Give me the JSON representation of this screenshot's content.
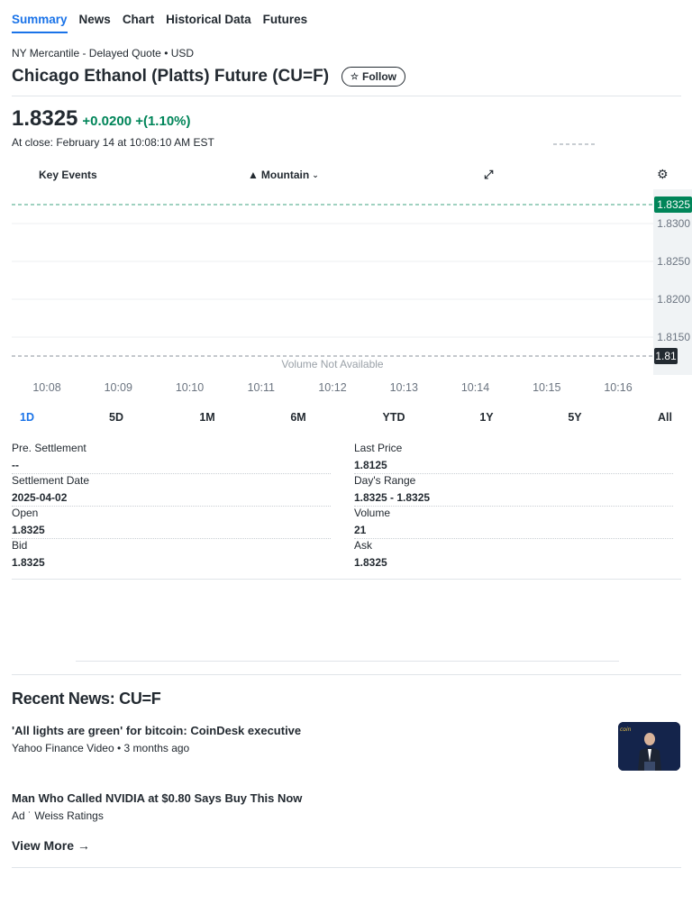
{
  "tabs": [
    {
      "label": "Summary",
      "active": true
    },
    {
      "label": "News",
      "active": false
    },
    {
      "label": "Chart",
      "active": false
    },
    {
      "label": "Historical Data",
      "active": false
    },
    {
      "label": "Futures",
      "active": false
    }
  ],
  "quote": {
    "exchange": "NY Mercantile - Delayed Quote • USD",
    "title": "Chicago Ethanol (Platts) Future (CU=F)",
    "follow_label": "Follow",
    "price": "1.8325",
    "change": "+0.0200 +(1.10%)",
    "close_time": "At close: February 14 at 10:08:10 AM EST"
  },
  "chart_toolbar": {
    "key_events": "Key Events",
    "chart_type": "Mountain",
    "expand_icon": "expand-icon",
    "settings_icon": "gear-icon"
  },
  "chart_data": {
    "type": "line",
    "x_labels": [
      "10:08",
      "10:09",
      "10:10",
      "10:11",
      "10:12",
      "10:13",
      "10:14",
      "10:15",
      "10:16"
    ],
    "y_ticks": [
      "1.8300",
      "1.8250",
      "1.8200",
      "1.8150"
    ],
    "ylim": [
      1.8125,
      1.8325
    ],
    "current_price_label": "1.8325",
    "previous_close_label": "1.81",
    "current_price": 1.8325,
    "previous_close": 1.8125,
    "volume_note": "Volume Not Available",
    "current_color": "#008559",
    "previous_close_color": "#232a31",
    "grid": true
  },
  "periods": [
    {
      "label": "1D",
      "active": true
    },
    {
      "label": "5D",
      "active": false
    },
    {
      "label": "1M",
      "active": false
    },
    {
      "label": "6M",
      "active": false
    },
    {
      "label": "YTD",
      "active": false
    },
    {
      "label": "1Y",
      "active": false
    },
    {
      "label": "5Y",
      "active": false
    },
    {
      "label": "All",
      "active": false
    }
  ],
  "stats": {
    "pre_settlement": {
      "label": "Pre. Settlement",
      "value": "--"
    },
    "settlement_date": {
      "label": "Settlement Date",
      "value": "2025-04-02"
    },
    "open": {
      "label": "Open",
      "value": "1.8325"
    },
    "bid": {
      "label": "Bid",
      "value": "1.8325"
    },
    "last_price": {
      "label": "Last Price",
      "value": "1.8125"
    },
    "days_range": {
      "label": "Day's Range",
      "value": "1.8325 - 1.8325"
    },
    "volume": {
      "label": "Volume",
      "value": "21"
    },
    "ask": {
      "label": "Ask",
      "value": "1.8325"
    }
  },
  "news": {
    "heading": "Recent News: CU=F",
    "items": [
      {
        "title": "'All lights are green' for bitcoin: CoinDesk executive",
        "meta": "Yahoo Finance Video • 3 months ago"
      },
      {
        "title": "Man Who Called NVIDIA at $0.80 Says Buy This Now",
        "meta": "Ad ˙ Weiss Ratings"
      }
    ],
    "view_more": "View More →"
  },
  "colors": {
    "accent": "#1a73e8",
    "positive": "#008559",
    "text": "#232a31"
  }
}
